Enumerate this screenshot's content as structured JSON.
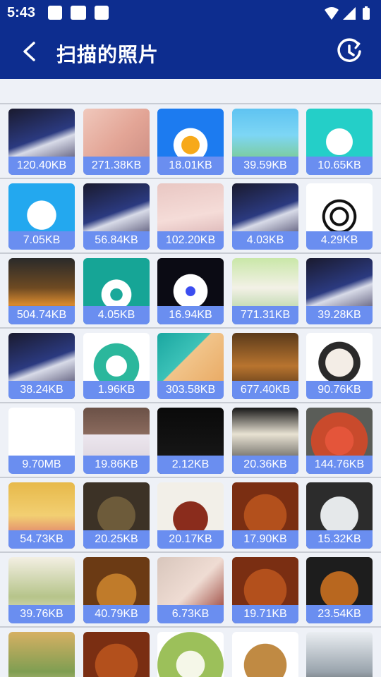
{
  "status_bar": {
    "time": "5:43"
  },
  "header": {
    "title": "扫描的照片"
  },
  "photos": [
    {
      "size": "120.40KB",
      "thumb": "dark-portrait"
    },
    {
      "size": "271.38KB",
      "thumb": "skin-portrait"
    },
    {
      "size": "18.01KB",
      "thumb": "blue-p-app-icon"
    },
    {
      "size": "39.59KB",
      "thumb": "cartoon-app-icon"
    },
    {
      "size": "10.65KB",
      "thumb": "music-app-icon"
    },
    {
      "size": "7.05KB",
      "thumb": "voice-app-icon"
    },
    {
      "size": "56.84KB",
      "thumb": "dark-portrait"
    },
    {
      "size": "102.20KB",
      "thumb": "pink-dress-portrait"
    },
    {
      "size": "4.03KB",
      "thumb": "dark-portrait"
    },
    {
      "size": "4.29KB",
      "thumb": "spiral-logo"
    },
    {
      "size": "504.74KB",
      "thumb": "movie-poster"
    },
    {
      "size": "4.05KB",
      "thumb": "camera-app-icon"
    },
    {
      "size": "16.94KB",
      "thumb": "speaker-app-icon"
    },
    {
      "size": "771.31KB",
      "thumb": "cartoon-character"
    },
    {
      "size": "39.28KB",
      "thumb": "dark-portrait"
    },
    {
      "size": "38.24KB",
      "thumb": "dark-portrait"
    },
    {
      "size": "1.96KB",
      "thumb": "scan-app-icon"
    },
    {
      "size": "303.58KB",
      "thumb": "chess-app-icon"
    },
    {
      "size": "677.40KB",
      "thumb": "game-screenshot"
    },
    {
      "size": "90.76KB",
      "thumb": "anime-girl"
    },
    {
      "size": "9.70MB",
      "thumb": "blank-white"
    },
    {
      "size": "19.86KB",
      "thumb": "anime-hat-girl"
    },
    {
      "size": "2.12KB",
      "thumb": "loading-banner"
    },
    {
      "size": "20.36KB",
      "thumb": "noodle-food"
    },
    {
      "size": "144.76KB",
      "thumb": "stir-fry-food"
    },
    {
      "size": "54.73KB",
      "thumb": "egg-tart-food"
    },
    {
      "size": "20.25KB",
      "thumb": "abalone-food"
    },
    {
      "size": "20.17KB",
      "thumb": "braised-meat-food"
    },
    {
      "size": "17.90KB",
      "thumb": "chicken-wings-food"
    },
    {
      "size": "15.32KB",
      "thumb": "dumplings-food"
    },
    {
      "size": "39.76KB",
      "thumb": "rice-roll-food"
    },
    {
      "size": "40.79KB",
      "thumb": "spicy-pot-food"
    },
    {
      "size": "6.73KB",
      "thumb": "cola-chicken-food"
    },
    {
      "size": "19.71KB",
      "thumb": "chicken-wings-food"
    },
    {
      "size": "23.54KB",
      "thumb": "braised-fish-food"
    },
    {
      "size": "",
      "thumb": "pancake-food"
    },
    {
      "size": "",
      "thumb": "chicken-wings-food"
    },
    {
      "size": "",
      "thumb": "cabbage"
    },
    {
      "size": "",
      "thumb": "potato"
    },
    {
      "size": "",
      "thumb": "toys-photo"
    }
  ],
  "colors": {
    "primary": "#0d2d8f",
    "label_bg": "#6a8ef0",
    "page_bg": "#eef1f7"
  }
}
